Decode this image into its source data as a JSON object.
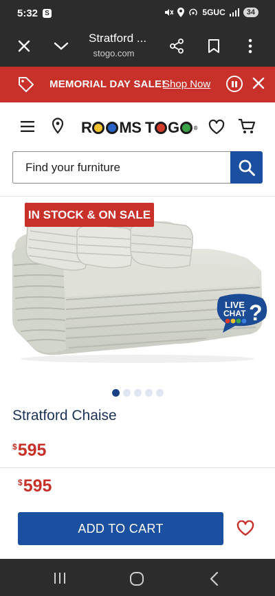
{
  "status_bar": {
    "time": "5:32",
    "app_badge": "S",
    "network": "5GUC",
    "battery": "34"
  },
  "browser": {
    "title": "Stratford ...",
    "url": " stogo.com"
  },
  "promo": {
    "text": "MEMORIAL DAY SALE!",
    "link": "Shop Now"
  },
  "header": {
    "logo_parts": [
      "R",
      "MS T",
      " G"
    ],
    "logo_full": "ROOMS TO GO"
  },
  "search": {
    "placeholder": "Find your furniture"
  },
  "product": {
    "badge": "IN STOCK & ON SALE",
    "title": "Stratford Chaise",
    "price_symbol": "$",
    "price": "595",
    "carousel_count": 5,
    "carousel_active": 0
  },
  "live_chat": {
    "line1": "LIVE",
    "line2": "CHAT"
  },
  "sticky": {
    "price_symbol": "$",
    "price": "595",
    "cta": "ADD TO CART"
  },
  "colors": {
    "brand_red": "#c8302a",
    "brand_blue": "#1b4fa0",
    "title_navy": "#1b3158",
    "chrome_dark": "#2c2c2c"
  }
}
